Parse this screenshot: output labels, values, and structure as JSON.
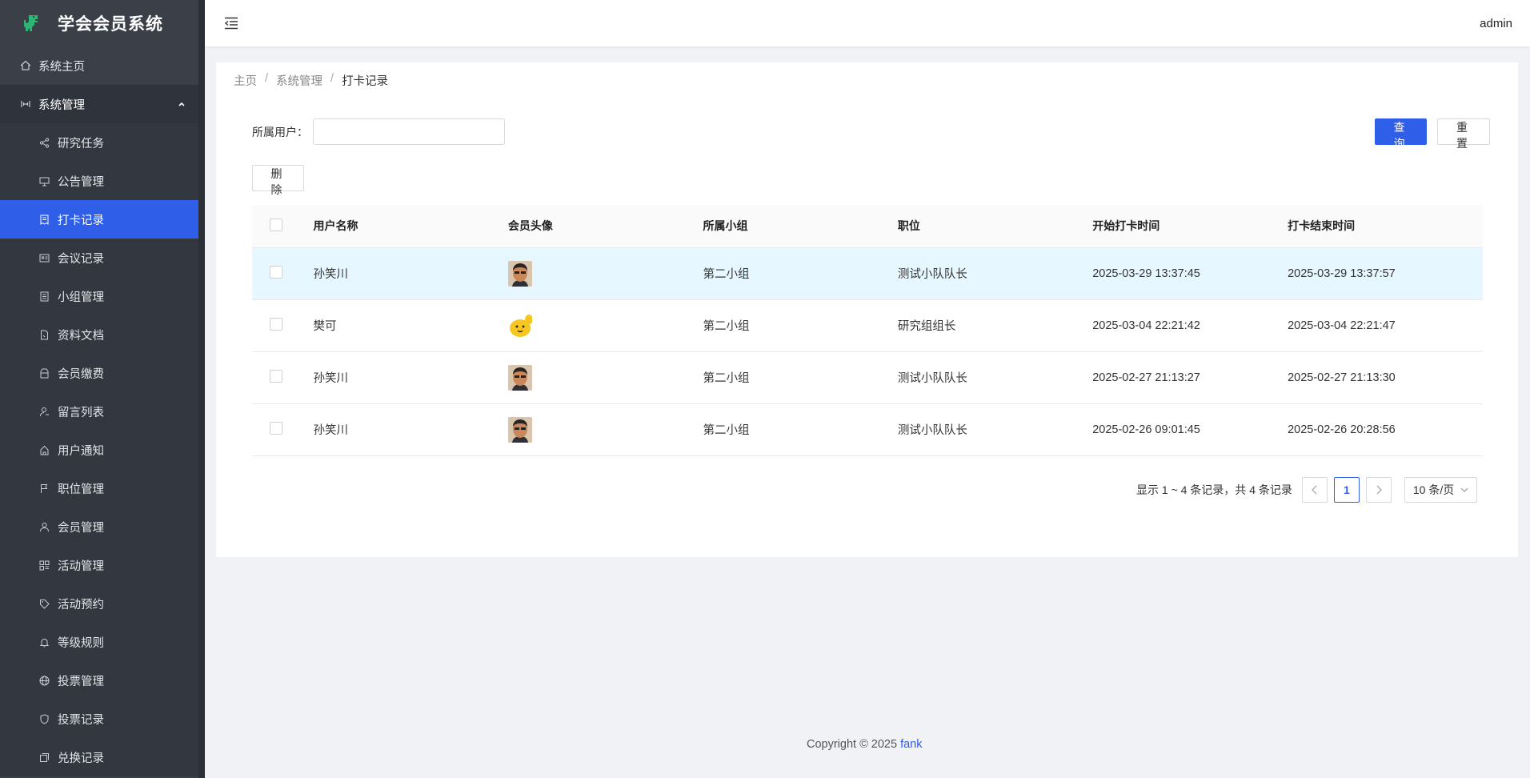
{
  "app": {
    "title": "学会会员系统"
  },
  "sidebar": {
    "home": {
      "label": "系统主页",
      "icon": "home-icon"
    },
    "group": {
      "label": "系统管理",
      "icon": "system-icon"
    },
    "items": [
      {
        "label": "研究任务",
        "icon": "share-icon"
      },
      {
        "label": "公告管理",
        "icon": "monitor-icon"
      },
      {
        "label": "打卡记录",
        "icon": "receipt-icon",
        "active": true
      },
      {
        "label": "会议记录",
        "icon": "id-card-icon"
      },
      {
        "label": "小组管理",
        "icon": "list-icon"
      },
      {
        "label": "资料文档",
        "icon": "file-icon"
      },
      {
        "label": "会员缴费",
        "icon": "wallet-icon"
      },
      {
        "label": "留言列表",
        "icon": "user-message-icon"
      },
      {
        "label": "用户通知",
        "icon": "house-bell-icon"
      },
      {
        "label": "职位管理",
        "icon": "flag-icon"
      },
      {
        "label": "会员管理",
        "icon": "user-icon"
      },
      {
        "label": "活动管理",
        "icon": "grid-icon"
      },
      {
        "label": "活动预约",
        "icon": "tag-icon"
      },
      {
        "label": "等级规则",
        "icon": "bell-icon"
      },
      {
        "label": "投票管理",
        "icon": "globe-icon"
      },
      {
        "label": "投票记录",
        "icon": "shield-icon"
      },
      {
        "label": "兑换记录",
        "icon": "copy-icon"
      }
    ]
  },
  "header": {
    "user": "admin"
  },
  "breadcrumb": {
    "home": "主页",
    "parent": "系统管理",
    "current": "打卡记录"
  },
  "search": {
    "label": "所属用户：",
    "value": "",
    "placeholder": ""
  },
  "buttons": {
    "query": "查询",
    "reset": "重置",
    "delete": "删除"
  },
  "table": {
    "columns": [
      "用户名称",
      "会员头像",
      "所属小组",
      "职位",
      "开始打卡时间",
      "打卡结束时间"
    ],
    "rows": [
      {
        "name": "孙笑川",
        "avatar": "face-avatar",
        "group": "第二小组",
        "position": "测试小队队长",
        "start": "2025-03-29 13:37:45",
        "end": "2025-03-29 13:37:57"
      },
      {
        "name": "樊可",
        "avatar": "cartoon-avatar",
        "group": "第二小组",
        "position": "研究组组长",
        "start": "2025-03-04 22:21:42",
        "end": "2025-03-04 22:21:47"
      },
      {
        "name": "孙笑川",
        "avatar": "face-avatar",
        "group": "第二小组",
        "position": "测试小队队长",
        "start": "2025-02-27 21:13:27",
        "end": "2025-02-27 21:13:30"
      },
      {
        "name": "孙笑川",
        "avatar": "face-avatar",
        "group": "第二小组",
        "position": "测试小队队长",
        "start": "2025-02-26 09:01:45",
        "end": "2025-02-26 20:28:56"
      }
    ]
  },
  "pagination": {
    "summary": "显示 1 ~ 4 条记录，共 4 条记录",
    "current_page": "1",
    "page_size": "10 条/页"
  },
  "footer": {
    "copyright": "Copyright © 2025",
    "author": "fank"
  },
  "colors": {
    "primary": "#2f5ee8",
    "sidebar": "#3a3f48",
    "row_highlight": "#e6f7ff"
  }
}
